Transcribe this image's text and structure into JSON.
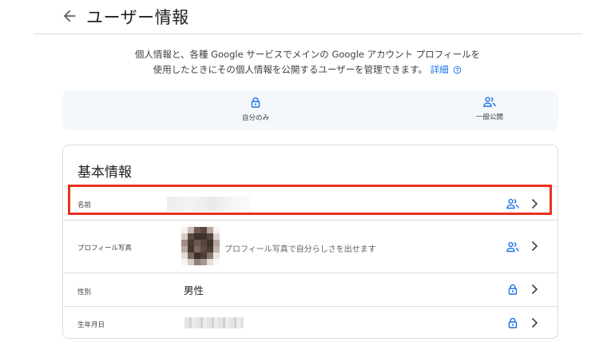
{
  "header": {
    "title": "ユーザー情報",
    "back_icon": "arrow-back-icon"
  },
  "intro": {
    "line1": "個人情報と、各種 Google サービスでメインの Google アカウント プロフィールを",
    "line2": "使用したときにその個人情報を公開するユーザーを管理できます。",
    "link": "詳細",
    "help_icon": "help-circle-icon"
  },
  "legend": {
    "private": {
      "label": "自分のみ",
      "icon": "lock-icon"
    },
    "public": {
      "label": "一般公開",
      "icon": "people-icon"
    }
  },
  "card": {
    "title": "基本情報",
    "rows": [
      {
        "label": "名前",
        "visibility_icon": "people-icon"
      },
      {
        "label": "プロフィール写真",
        "value": "プロフィール写真で自分らしさを出せます",
        "visibility_icon": "people-icon"
      },
      {
        "label": "性別",
        "value": "男性",
        "visibility_icon": "lock-icon"
      },
      {
        "label": "生年月日",
        "visibility_icon": "lock-icon"
      }
    ]
  },
  "colors": {
    "accent": "#1a73e8",
    "highlight": "#e8321f",
    "legend_bg": "#f4f7fc",
    "divider": "#dadce0"
  }
}
